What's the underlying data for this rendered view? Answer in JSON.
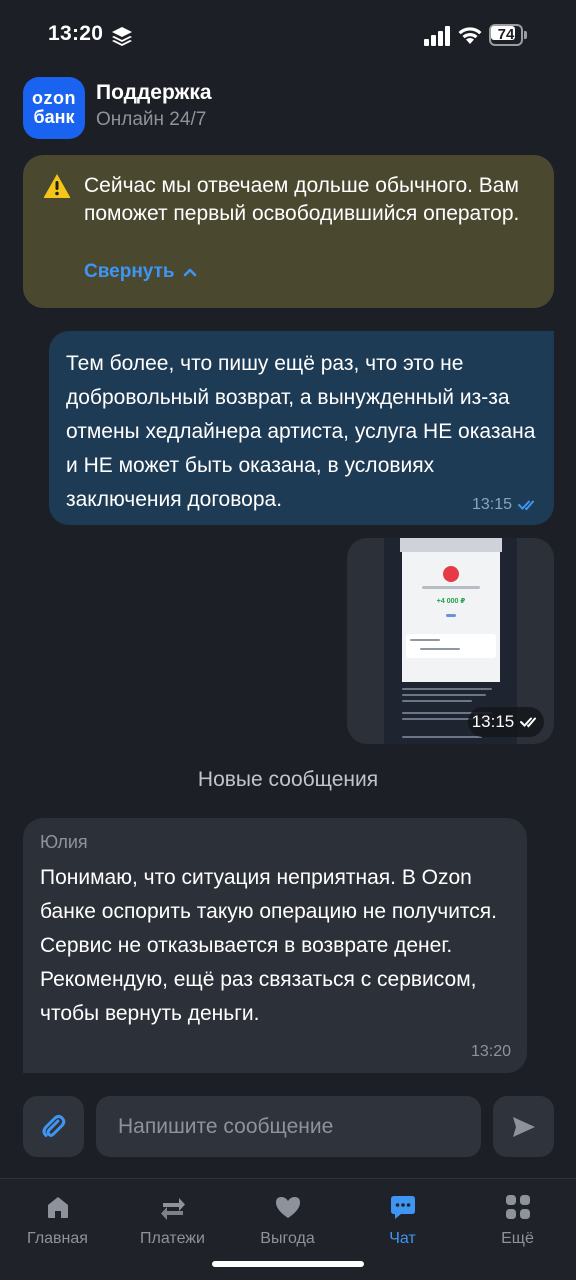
{
  "status_bar": {
    "time": "13:20",
    "battery": "74"
  },
  "header": {
    "logo_line1": "ozon",
    "logo_line2": "банк",
    "title": "Поддержка",
    "subtitle": "Онлайн 24/7"
  },
  "notice": {
    "text": "Сейчас мы отвечаем дольше обычного. Вам поможет первый освободившийся оператор.",
    "collapse_label": "Свернуть"
  },
  "messages": {
    "outgoing": {
      "text": "Тем более, что пишу ещё раз, что это не добровольный возврат, а вынужденный из-за отмены хедлайнера артиста, услуга НЕ оказана и НЕ может быть оказана, в условиях заключения договора.",
      "time": "13:15"
    },
    "image": {
      "amount": "+4 000 ₽",
      "time": "13:15"
    },
    "divider": "Новые сообщения",
    "incoming": {
      "author": "Юлия",
      "text": "Понимаю, что ситуация неприятная. В Ozon банке оспорить такую операцию не получится. Сервис не отказывается в возврате денег. Рекомендую, ещё раз связаться с сервисом, чтобы вернуть деньги.",
      "time": "13:20"
    }
  },
  "composer": {
    "placeholder": "Напишите сообщение"
  },
  "nav": [
    {
      "label": "Главная",
      "icon": "home-icon"
    },
    {
      "label": "Платежи",
      "icon": "transfer-arrows-icon"
    },
    {
      "label": "Выгода",
      "icon": "heart-icon"
    },
    {
      "label": "Чат",
      "icon": "chat-icon",
      "active": true
    },
    {
      "label": "Ещё",
      "icon": "grid-icon"
    }
  ],
  "colors": {
    "background": "#1c1f25",
    "accent": "#3f95f2",
    "brand": "#1a63f0",
    "outgoing_bubble": "#1e3b55",
    "incoming_bubble": "#2c3038",
    "notice_bg": "#4b4830",
    "warning": "#f5c518"
  }
}
